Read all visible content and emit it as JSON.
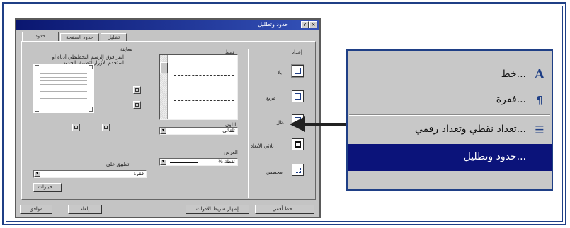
{
  "dialog": {
    "title": "حدود وتظليل",
    "help_icon": "question-icon",
    "close_icon": "close-icon",
    "tabs": [
      "حدود",
      "حدود الصفحة",
      "تظليل"
    ],
    "setting_label": "إعداد",
    "settings": [
      "بلا",
      "مربع",
      "ظل",
      "ثلاثي الأبعاد",
      "مخصص"
    ],
    "style_label": "نمط",
    "color_label": "اللون",
    "color_value": "تلقائي",
    "width_label": "العرض",
    "width_value": "½ نقطة",
    "preview_label": "معاينة",
    "preview_hint": "انقر فوق الرسم التخطيطي أدناه أو استخدم الأزرار لتطبيق الحدود",
    "apply_to_label": "تطبيق على:",
    "apply_to_value": "فقرة",
    "options_button": "خيارات...",
    "buttons": {
      "ok": "موافق",
      "cancel": "إلغاء",
      "toolbar": "إظهار شريط الأدوات",
      "horizontal_line": "خط أفقي..."
    }
  },
  "menu": {
    "items": [
      {
        "label": "خط...",
        "icon": "font-A-icon"
      },
      {
        "label": "فقرة...",
        "icon": "paragraph-icon"
      },
      {
        "label": "تعداد نقطي وتعداد رقمي...",
        "icon": "bullets-icon"
      },
      {
        "label": "حدود وتظليل...",
        "icon": ""
      }
    ],
    "highlight_color": "#0b137a"
  },
  "colors": {
    "accent": "#1f3f86",
    "dialog_bg": "#c4c4c4",
    "title_bar": "#0a1670"
  }
}
